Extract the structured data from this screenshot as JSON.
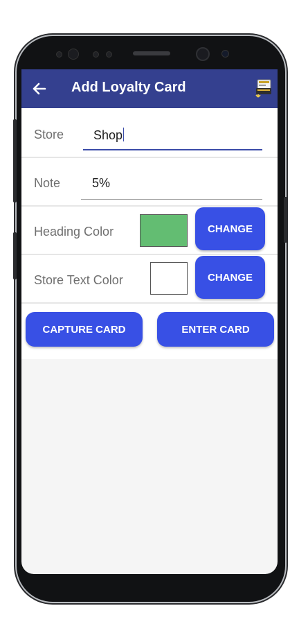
{
  "appbar": {
    "title": "Add Loyalty Card",
    "back_icon": "arrow-left-icon",
    "save_icon": "save-card-icon"
  },
  "store": {
    "label": "Store",
    "value": "Shop"
  },
  "note": {
    "label": "Note",
    "value": "5%"
  },
  "heading_color": {
    "label": "Heading Color",
    "swatch": "#63bd72",
    "button": "CHANGE"
  },
  "store_text_color": {
    "label": "Store Text Color",
    "swatch": "#ffffff",
    "button": "CHANGE"
  },
  "actions": {
    "capture": "CAPTURE CARD",
    "enter": "ENTER CARD"
  },
  "colors": {
    "appbar": "#34408f",
    "accent": "#3850e5"
  }
}
